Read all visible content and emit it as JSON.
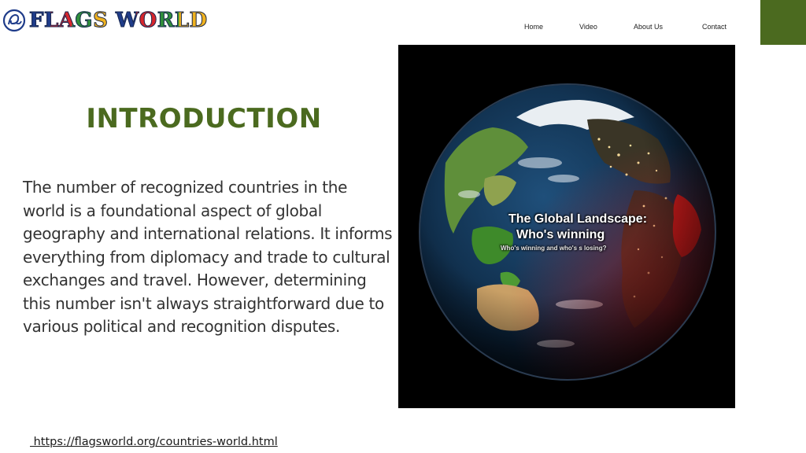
{
  "brand": {
    "logo_text": "FLAGS WORLD",
    "accent_color": "#4b6a1f"
  },
  "nav": {
    "items": [
      {
        "label": "Home"
      },
      {
        "label": "Video"
      },
      {
        "label": "About Us"
      },
      {
        "label": "Contact"
      }
    ]
  },
  "main": {
    "heading": "INTRODUCTION",
    "paragraph": "The number of recognized countries in the world is a foundational aspect of global geography and international relations. It informs everything from diplomacy and trade to cultural exchanges and travel. However, determining this number isn't always straightforward due to various political and recognition disputes."
  },
  "image": {
    "caption_title": "The Global Landscape:",
    "caption_subtitle": "Who's winning",
    "caption_small": "Who's winning and who's s losing?"
  },
  "footer": {
    "source_link": " https://flagsworld.org/countries-world.html"
  }
}
